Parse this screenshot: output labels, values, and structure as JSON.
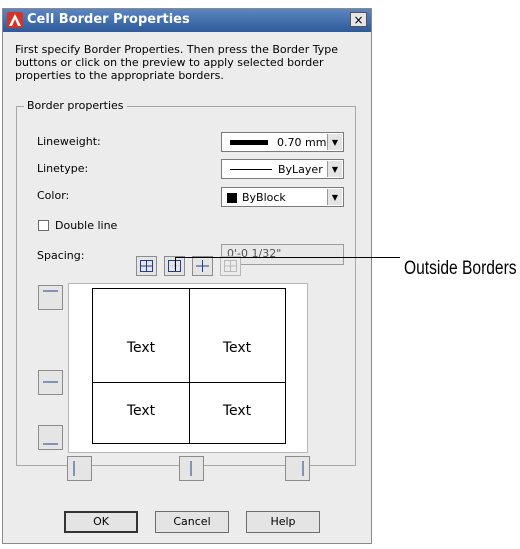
{
  "dialog": {
    "title": "Cell Border Properties",
    "close_symbol": "×",
    "intro": "First specify Border Properties. Then press the Border Type buttons or click on the preview to apply selected border properties to the appropriate borders."
  },
  "border_properties": {
    "group_label": "Border properties",
    "lineweight": {
      "label": "Lineweight:",
      "value": "0.70 mm"
    },
    "linetype": {
      "label": "Linetype:",
      "value": "ByLayer"
    },
    "color": {
      "label": "Color:",
      "value": "ByBlock",
      "swatch": "#000000"
    },
    "double_line": {
      "label": "Double line",
      "checked": false
    },
    "spacing": {
      "label": "Spacing:",
      "value": "0'-0 1/32\""
    }
  },
  "border_type_buttons": [
    {
      "name": "all-borders-icon",
      "enabled": true
    },
    {
      "name": "outside-borders-icon",
      "enabled": true
    },
    {
      "name": "inside-borders-icon",
      "enabled": true
    },
    {
      "name": "no-borders-icon",
      "enabled": false
    }
  ],
  "preview": {
    "cells": [
      "Text",
      "Text",
      "Text",
      "Text"
    ]
  },
  "buttons": {
    "ok": "OK",
    "cancel": "Cancel",
    "help": "Help"
  },
  "callout": {
    "text": "Outside Borders"
  }
}
